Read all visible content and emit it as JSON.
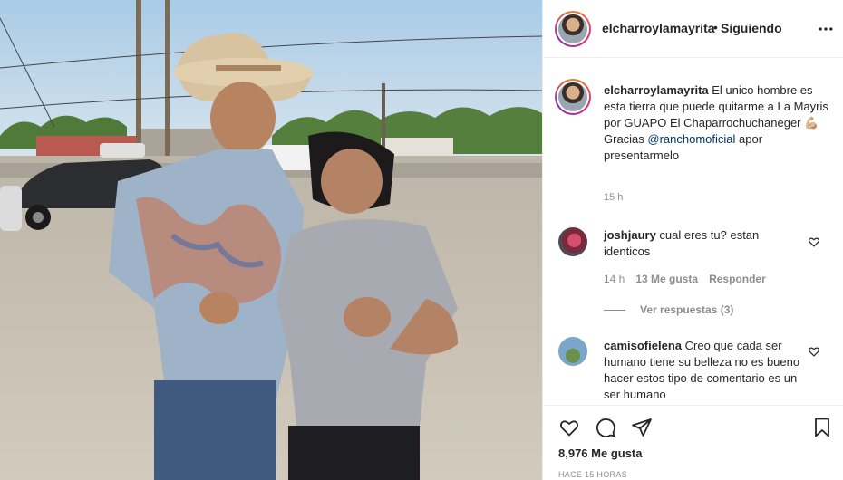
{
  "header": {
    "username": "elcharroylamayrita",
    "separator": "•",
    "follow_state": "Siguiendo"
  },
  "caption": {
    "username": "elcharroylamayrita",
    "text_part1": "El unico hombre es esta tierra que puede quitarme a La Mayris por GUAPO El Chaparrochuchaneger 💪🏼",
    "text_part2": "Gracias ",
    "mention": "@ranchomoficial",
    "text_part3": " apor presentarmelo",
    "time": "15 h"
  },
  "comments": [
    {
      "username": "joshjaury",
      "text": "cual eres tu? estan identicos",
      "time": "14 h",
      "likes": "13 Me gusta",
      "reply_label": "Responder",
      "view_replies": "Ver respuestas (3)"
    },
    {
      "username": "camisofielena",
      "text": "Creo que cada ser humano tiene su belleza no es bueno hacer estos tipo de comentario es un ser humano"
    }
  ],
  "footer": {
    "likes": "8,976 Me gusta",
    "posted": "HACE 15 HORAS"
  },
  "icons": {
    "more": "more-horizontal-icon",
    "like": "heart-outline-icon",
    "comment": "comment-bubble-icon",
    "share": "paper-plane-icon",
    "save": "bookmark-icon",
    "comment_like": "small-heart-icon"
  },
  "colors": {
    "text": "#262626",
    "muted": "#8e8e8e",
    "mention": "#00376b",
    "border": "#efefef"
  }
}
